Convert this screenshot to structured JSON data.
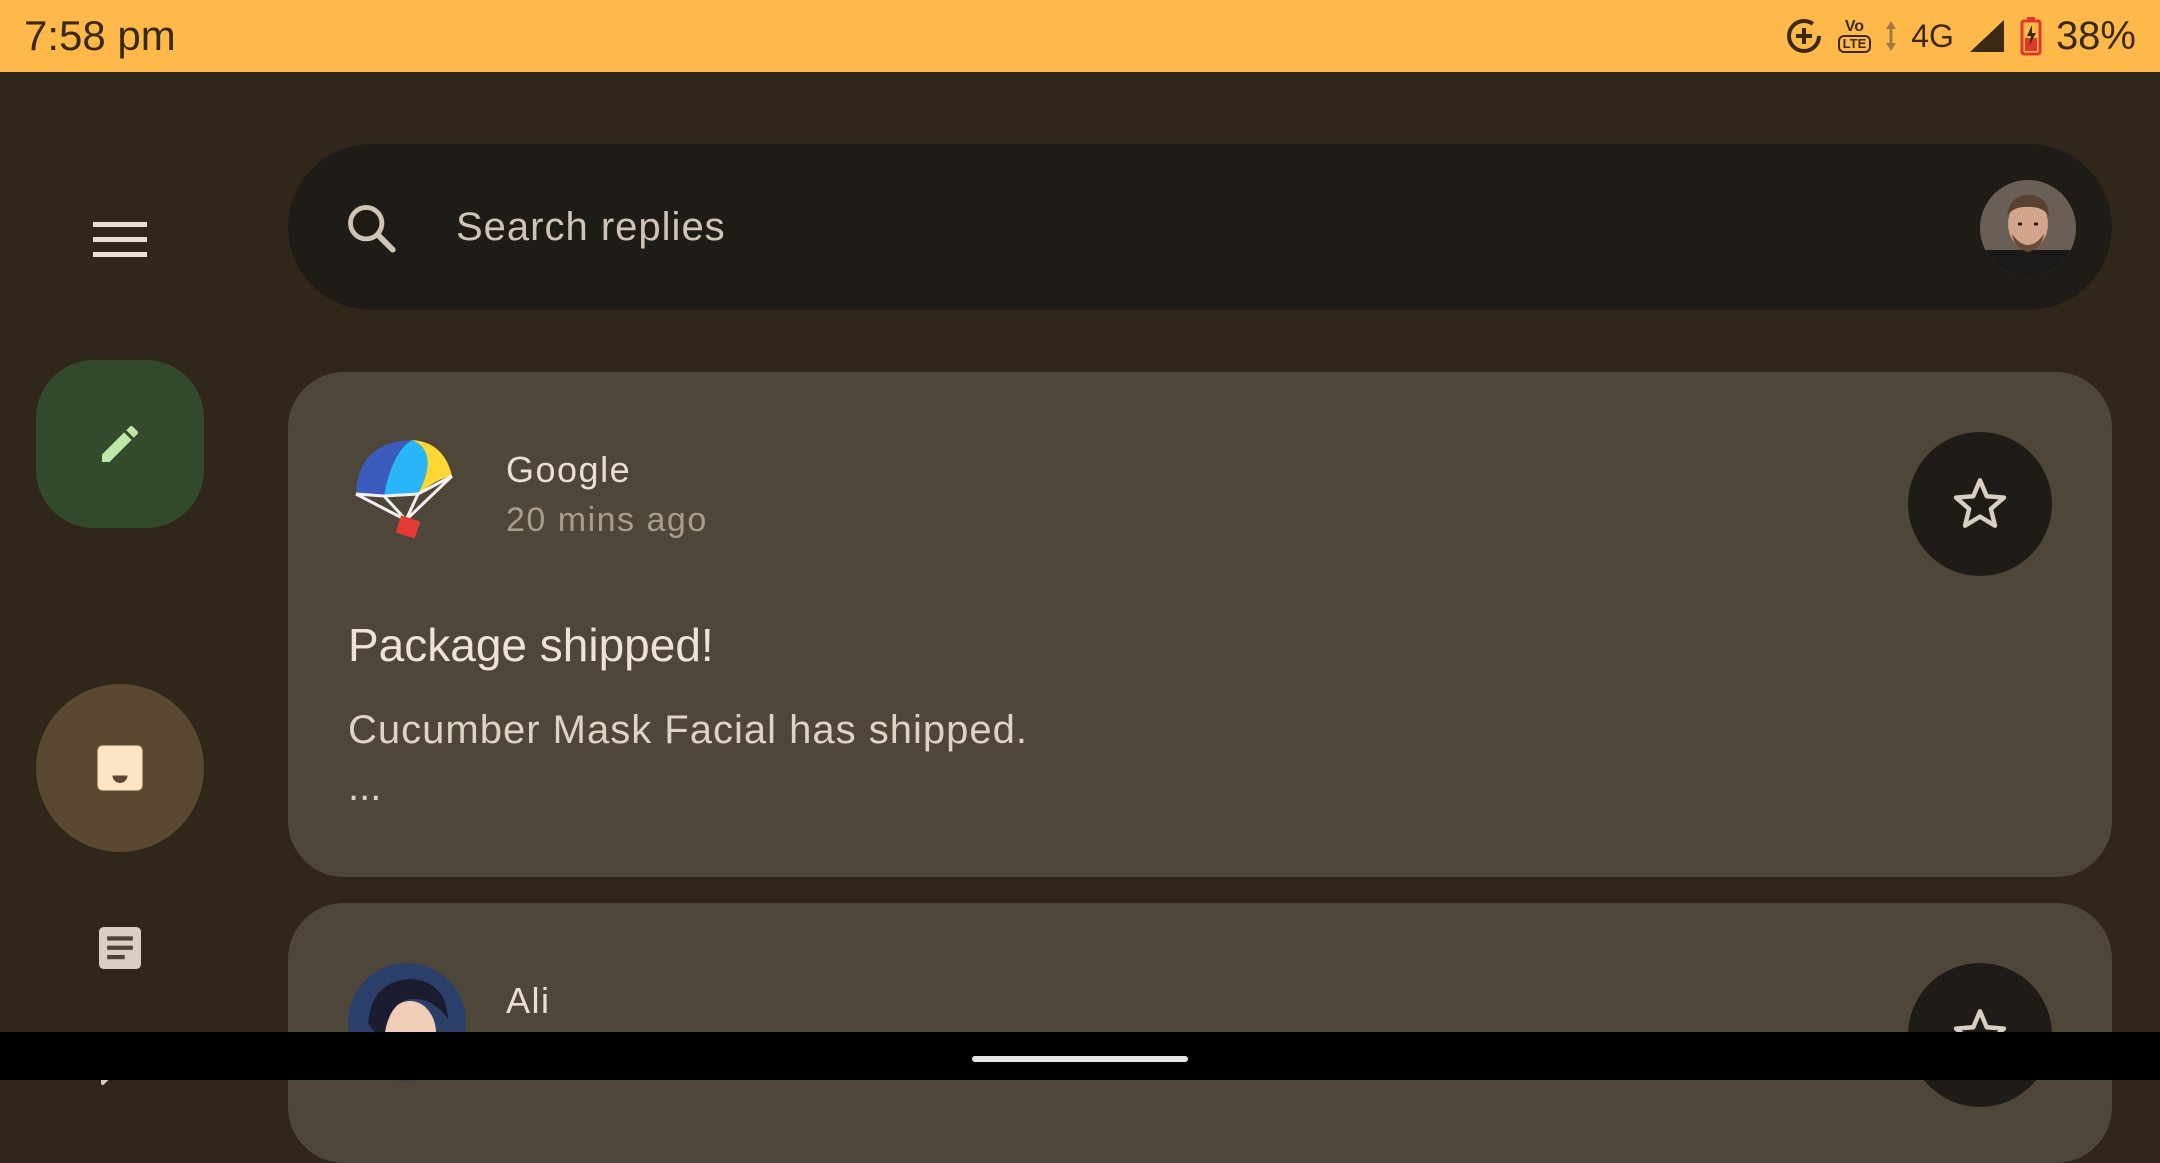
{
  "status_bar": {
    "time": "7:58 pm",
    "network": "4G",
    "volte_top": "Vo",
    "volte_bottom": "LTE",
    "battery": "38%",
    "background_color": "#ffb84a"
  },
  "nav_rail": {
    "items": [
      {
        "icon": "menu-icon"
      },
      {
        "icon": "pencil-icon",
        "role": "compose"
      },
      {
        "icon": "inbox-icon",
        "selected": true
      },
      {
        "icon": "article-icon"
      },
      {
        "icon": "chat-icon"
      }
    ]
  },
  "search": {
    "placeholder": "Search replies"
  },
  "emails": [
    {
      "sender": "Google",
      "time": "20 mins ago",
      "subject": "Package shipped!",
      "preview": "Cucumber Mask Facial has shipped.",
      "more": "...",
      "starred": false,
      "avatar_icon": "parachute-icon"
    },
    {
      "sender": "Ali",
      "starred": false
    }
  ],
  "colors": {
    "background": "#30271a",
    "card": "#4f463a",
    "compose_fab": "#344a2c",
    "selected_nav": "#5a4830",
    "search_bar": "#1f1c17"
  }
}
